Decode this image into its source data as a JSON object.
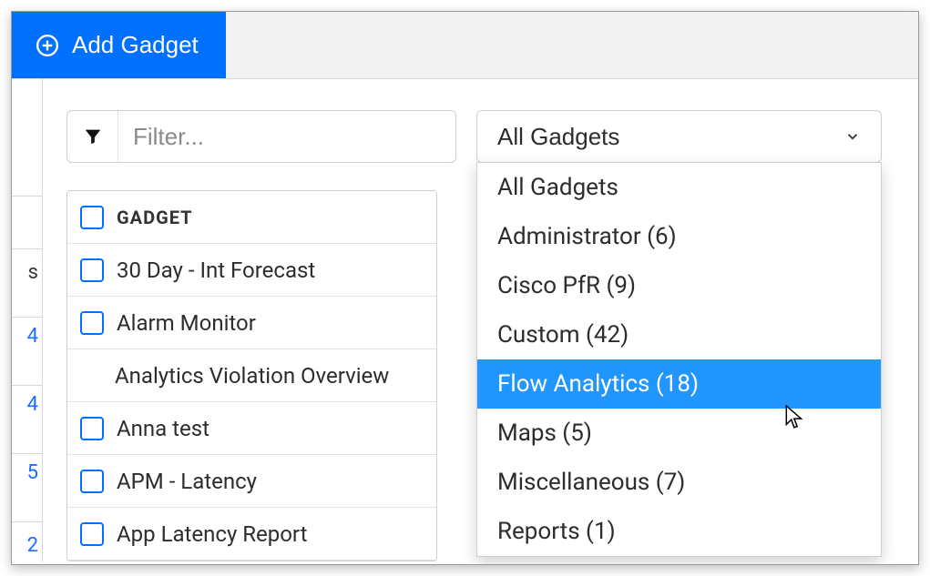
{
  "toolbar": {
    "add_gadget_label": "Add Gadget"
  },
  "filter": {
    "placeholder": "Filter..."
  },
  "dropdown": {
    "selected": "All Gadgets",
    "options": [
      {
        "label": "All Gadgets",
        "highlight": false
      },
      {
        "label": "Administrator (6)",
        "highlight": false
      },
      {
        "label": "Cisco PfR (9)",
        "highlight": false
      },
      {
        "label": "Custom (42)",
        "highlight": false
      },
      {
        "label": "Flow Analytics (18)",
        "highlight": true
      },
      {
        "label": "Maps (5)",
        "highlight": false
      },
      {
        "label": "Miscellaneous (7)",
        "highlight": false
      },
      {
        "label": "Reports (1)",
        "highlight": false
      }
    ]
  },
  "table": {
    "header": "GADGET",
    "rows": [
      {
        "label": "30 Day - Int Forecast",
        "has_checkbox": true
      },
      {
        "label": "Alarm Monitor",
        "has_checkbox": true
      },
      {
        "label": "Analytics Violation Overview",
        "has_checkbox": false
      },
      {
        "label": "Anna test",
        "has_checkbox": true
      },
      {
        "label": "APM - Latency",
        "has_checkbox": true
      },
      {
        "label": "App Latency Report",
        "has_checkbox": true
      }
    ]
  },
  "gutter": {
    "text0": "s",
    "n0": "4",
    "n1": "4",
    "n2": "5",
    "n3": "2"
  }
}
